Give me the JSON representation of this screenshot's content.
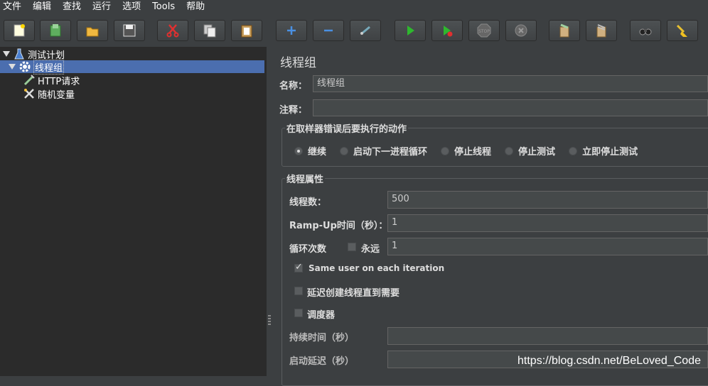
{
  "menu": [
    "文件",
    "编辑",
    "查找",
    "运行",
    "选项",
    "Tools",
    "帮助"
  ],
  "toolbar_icons": [
    "new-icon",
    "templates-icon",
    "open-icon",
    "save-icon",
    "cut-icon",
    "copy-icon",
    "paste-icon",
    "expand-icon",
    "collapse-icon",
    "toggle-icon",
    "start-icon",
    "start-no-pause-icon",
    "stop-icon",
    "shutdown-icon",
    "clear-icon",
    "clear-all-icon",
    "search-icon",
    "reset-search-icon"
  ],
  "tree": {
    "test_plan": "测试计划",
    "thread_group": "线程组",
    "http_request": "HTTP请求",
    "random_variable": "随机变量"
  },
  "panel": {
    "title": "线程组",
    "name_label": "名称：",
    "name_value": "线程组",
    "comment_label": "注释：",
    "comment_value": "",
    "error_group_title": "在取样器错误后要执行的动作",
    "error_actions": [
      "继续",
      "启动下一进程循环",
      "停止线程",
      "停止测试",
      "立即停止测试"
    ],
    "selected_action": "继续",
    "props_title": "线程属性",
    "threads_label": "线程数：",
    "threads_value": "500",
    "rampup_label": "Ramp-Up时间（秒）：",
    "rampup_value": "1",
    "loop_label": "循环次数",
    "forever_label": "永远",
    "forever_checked": false,
    "loop_value": "1",
    "same_user_label": "Same user on each iteration",
    "same_user_checked": true,
    "delay_label": "延迟创建线程直到需要",
    "delay_checked": false,
    "scheduler_label": "调度器",
    "scheduler_checked": false,
    "duration_label": "持续时间（秒）",
    "duration_value": "",
    "startup_label": "启动延迟（秒）",
    "startup_value": ""
  },
  "watermark": "https://blog.csdn.net/BeLoved_Code"
}
